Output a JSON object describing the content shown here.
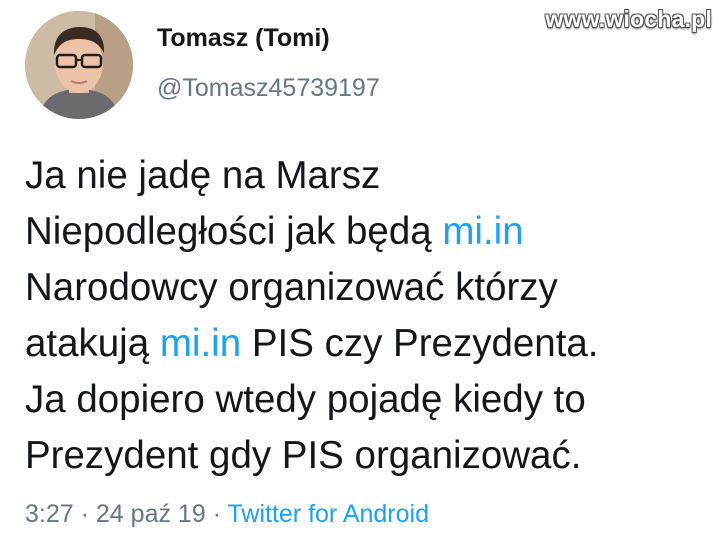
{
  "watermark": "www.wiocha.pl",
  "author": {
    "display_name": "Tomasz (Tomi)",
    "handle": "@Tomasz45739197"
  },
  "tweet": {
    "lines": [
      {
        "before": "Ja nie jadę na Marsz",
        "link": "",
        "after": ""
      },
      {
        "before": "Niepodległości jak będą ",
        "link": "mi.in",
        "after": ""
      },
      {
        "before": "Narodowcy organizować którzy",
        "link": "",
        "after": ""
      },
      {
        "before": "atakują ",
        "link": "mi.in",
        "after": " PIS czy Prezydenta."
      },
      {
        "before": "Ja dopiero wtedy pojadę kiedy to",
        "link": "",
        "after": ""
      },
      {
        "before": "Prezydent gdy PIS organizować.",
        "link": "",
        "after": ""
      }
    ]
  },
  "meta": {
    "time": "3:27",
    "date": "24 paź 19",
    "separator": "·",
    "source": "Twitter for Android"
  },
  "colors": {
    "link": "#1da1f2",
    "secondary_text": "#657786",
    "primary_text": "#14171a"
  }
}
